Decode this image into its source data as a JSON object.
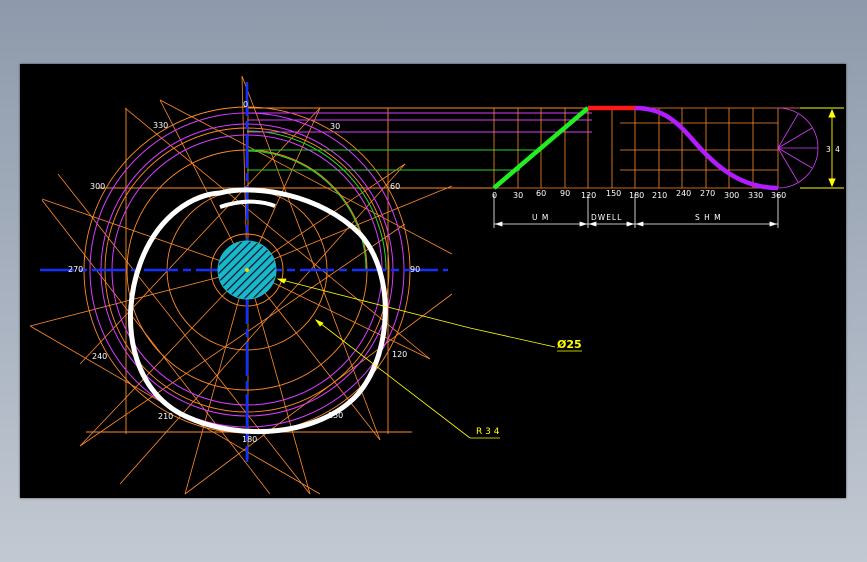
{
  "drawing": {
    "colors": {
      "background": "#000000",
      "construction": "#ff8a2a",
      "circle_magenta": "#d63cff",
      "circle_green": "#2bd12b",
      "centerline": "#1430ff",
      "cam_profile": "#ffffff",
      "hub_fill": "#18b8c8",
      "uniform_motion": "#22ee22",
      "dwell": "#ff1a1a",
      "shm": "#b21cff",
      "annotation": "#ffff00"
    },
    "cam_angles": {
      "a0": "0",
      "a30": "30",
      "a60": "60",
      "a90": "90",
      "a120": "120",
      "a150": "150",
      "a180": "180",
      "a210": "210",
      "a240": "240",
      "a270": "270",
      "a300": "300",
      "a330": "330"
    },
    "displacement_axis": {
      "ticks": [
        "0",
        "30",
        "60",
        "90",
        "120",
        "150",
        "180",
        "210",
        "240",
        "270",
        "300",
        "330",
        "360"
      ]
    },
    "segments": {
      "um": "U M",
      "dwell": "DWELL",
      "shm": "S H M"
    },
    "dimensions": {
      "lift": "3 4",
      "hub_diameter": "Ø25",
      "base_radius": "R 3 4"
    }
  }
}
